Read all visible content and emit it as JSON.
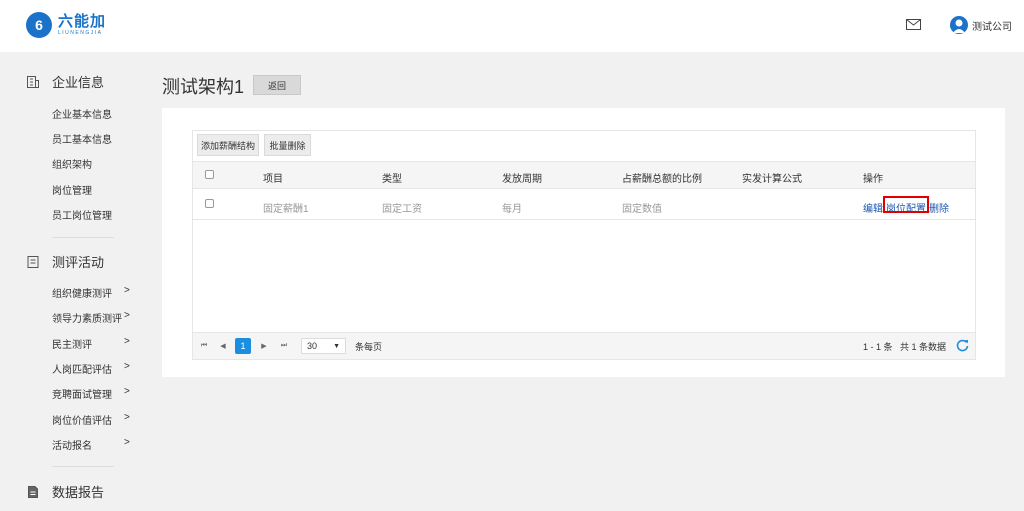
{
  "header": {
    "logo_mark": "6",
    "logo_cn": "六能加",
    "logo_en": "LIUNENGJIA",
    "user_name": "测试公司"
  },
  "sidebar": {
    "sections": [
      {
        "title": "企业信息",
        "items": [
          "企业基本信息",
          "员工基本信息",
          "组织架构",
          "岗位管理",
          "员工岗位管理"
        ]
      },
      {
        "title": "测评活动",
        "items": [
          "组织健康测评",
          "领导力素质测评",
          "民主测评",
          "人岗匹配评估",
          "竞聘面试管理",
          "岗位价值评估",
          "活动报名"
        ]
      },
      {
        "title": "数据报告",
        "items": []
      }
    ],
    "chevron": ">"
  },
  "main": {
    "title": "测试架构1",
    "back_label": "返回",
    "toolbar": {
      "add_label": "添加薪酬结构",
      "batch_delete_label": "批量删除"
    },
    "table": {
      "columns": [
        "项目",
        "类型",
        "发放周期",
        "占薪酬总额的比例",
        "实发计算公式",
        "操作"
      ],
      "rows": [
        {
          "item": "固定薪酬1",
          "type": "固定工资",
          "cycle": "每月",
          "ratio": "固定数值",
          "formula": "",
          "actions": [
            "编辑",
            "岗位配置",
            "删除"
          ]
        }
      ]
    },
    "pagination": {
      "first": "⏮",
      "prev": "◀",
      "current_page": "1",
      "next": "▶",
      "last": "⏭",
      "page_size": "30",
      "page_size_arrow": "▼",
      "per_page_label": "条每页",
      "summary": "1 - 1 条   共 1 条数据"
    }
  },
  "colors": {
    "accent": "#1a73c9",
    "pager_active": "#1a8fe0",
    "highlight": "#e00000"
  }
}
